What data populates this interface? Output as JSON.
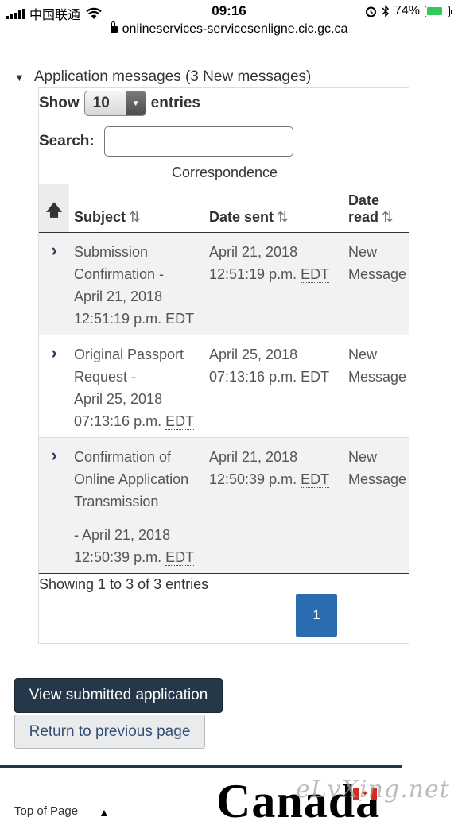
{
  "status_bar": {
    "carrier": "中国联通",
    "time": "09:16",
    "battery_pct": "74%",
    "battery_level": 0.74,
    "url": "onlineservices-servicesenligne.cic.gc.ca",
    "icons": [
      "signal-icon",
      "wifi-icon",
      "alarm-icon",
      "bluetooth-icon",
      "battery-icon",
      "lock-icon"
    ]
  },
  "section": {
    "summary": "Application messages (3 New messages)"
  },
  "table_controls": {
    "show_label": "Show",
    "entries_value": "10",
    "entries_label": "entries",
    "search_label": "Search:",
    "search_value": "",
    "caption": "Correspondence"
  },
  "table": {
    "headers": {
      "subject": "Subject",
      "date_sent": "Date sent",
      "date_read_line1": "Date",
      "date_read_line2": "read"
    },
    "rows": [
      {
        "subject_l1": "Submission",
        "subject_l2": "Confirmation -",
        "subject_l3": "April 21, 2018",
        "subject_l4": "12:51:19 p.m.",
        "subject_tz": "EDT",
        "sent_date": "April 21, 2018",
        "sent_time": "12:51:19 p.m.",
        "sent_tz": "EDT",
        "read_l1": "New",
        "read_l2": "Message"
      },
      {
        "subject_l1": "Original Passport",
        "subject_l2": "Request -",
        "subject_l3": "April 25, 2018",
        "subject_l4": "07:13:16 p.m.",
        "subject_tz": "EDT",
        "sent_date": "April 25, 2018",
        "sent_time": "07:13:16 p.m.",
        "sent_tz": "EDT",
        "read_l1": "New",
        "read_l2": "Message"
      },
      {
        "subject_l1": "Confirmation of",
        "subject_l2": "Online Application",
        "subject_l3": "Transmission",
        "subject_l4": "- April 21, 2018",
        "subject_l5": "12:50:39 p.m.",
        "subject_tz": "EDT",
        "sent_date": "April 21, 2018",
        "sent_time": "12:50:39 p.m.",
        "sent_tz": "EDT",
        "read_l1": "New",
        "read_l2": "Message"
      }
    ],
    "info": "Showing 1 to 3 of 3 entries",
    "current_page": "1"
  },
  "buttons": {
    "view_submitted": "View submitted application",
    "return_previous": "Return to previous page"
  },
  "footer": {
    "top_of_page": "Top of Page",
    "wordmark": "Canada",
    "watermark": "eLvXing.net"
  },
  "colors": {
    "primary_button": "#26374a",
    "page_button": "#2b6cb0",
    "link": "#335075"
  }
}
